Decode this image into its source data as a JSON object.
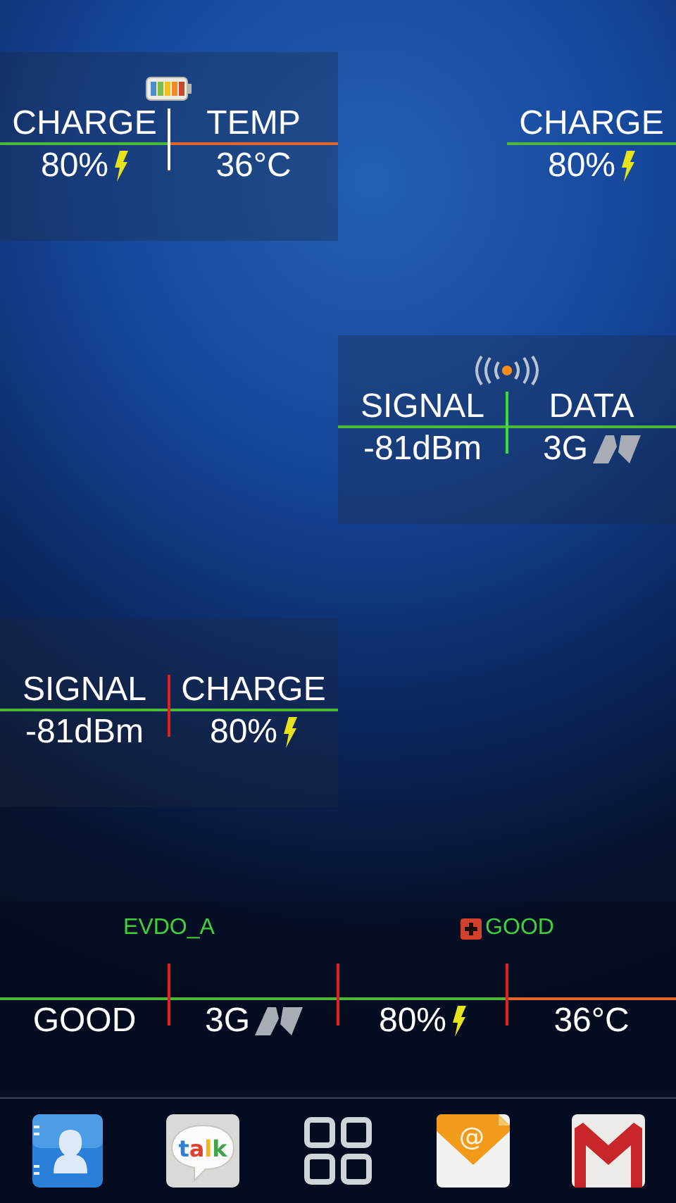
{
  "widgets": [
    {
      "kind": "battery",
      "columns": [
        {
          "kind": "charge",
          "label": "CHARGE",
          "value": "80%",
          "charging": true,
          "color": "#4cb83a"
        },
        {
          "kind": "temp",
          "label": "TEMP",
          "value": "36°C",
          "color": "#e0642c"
        }
      ]
    },
    {
      "kind": "bare",
      "columns": [
        {
          "kind": "charge",
          "label": "CHARGE",
          "value": "80%",
          "charging": true,
          "color": "#4cb83a"
        }
      ]
    },
    {
      "kind": "signal",
      "columns": [
        {
          "kind": "signal",
          "label": "SIGNAL",
          "value": "-81dBm",
          "color": "#4cb83a"
        },
        {
          "kind": "data",
          "label": "DATA",
          "value": "3G",
          "color": "#4cb83a"
        }
      ]
    },
    {
      "kind": "plain",
      "columns": [
        {
          "kind": "signal",
          "label": "SIGNAL",
          "value": "-81dBm",
          "color": "#4cb83a"
        },
        {
          "kind": "charge",
          "label": "CHARGE",
          "value": "80%",
          "charging": true,
          "color": "#4cb83a"
        }
      ]
    },
    {
      "kind": "strip",
      "captions": [
        {
          "kind": "network",
          "text": "EVDO_A"
        },
        {
          "kind": "health",
          "text": "GOOD"
        }
      ],
      "columns": [
        {
          "kind": "status",
          "value": "GOOD",
          "color": "#4cb83a"
        },
        {
          "kind": "data",
          "value": "3G",
          "color": "#4cb83a"
        },
        {
          "kind": "charge",
          "value": "80%",
          "charging": true,
          "color": "#4cb83a"
        },
        {
          "kind": "temp",
          "value": "36°C",
          "color": "#e0642c"
        }
      ]
    }
  ],
  "dock": [
    {
      "kind": "contacts"
    },
    {
      "kind": "talk",
      "text": "talk"
    },
    {
      "kind": "apps"
    },
    {
      "kind": "email",
      "text": "@"
    },
    {
      "kind": "gmail"
    }
  ]
}
